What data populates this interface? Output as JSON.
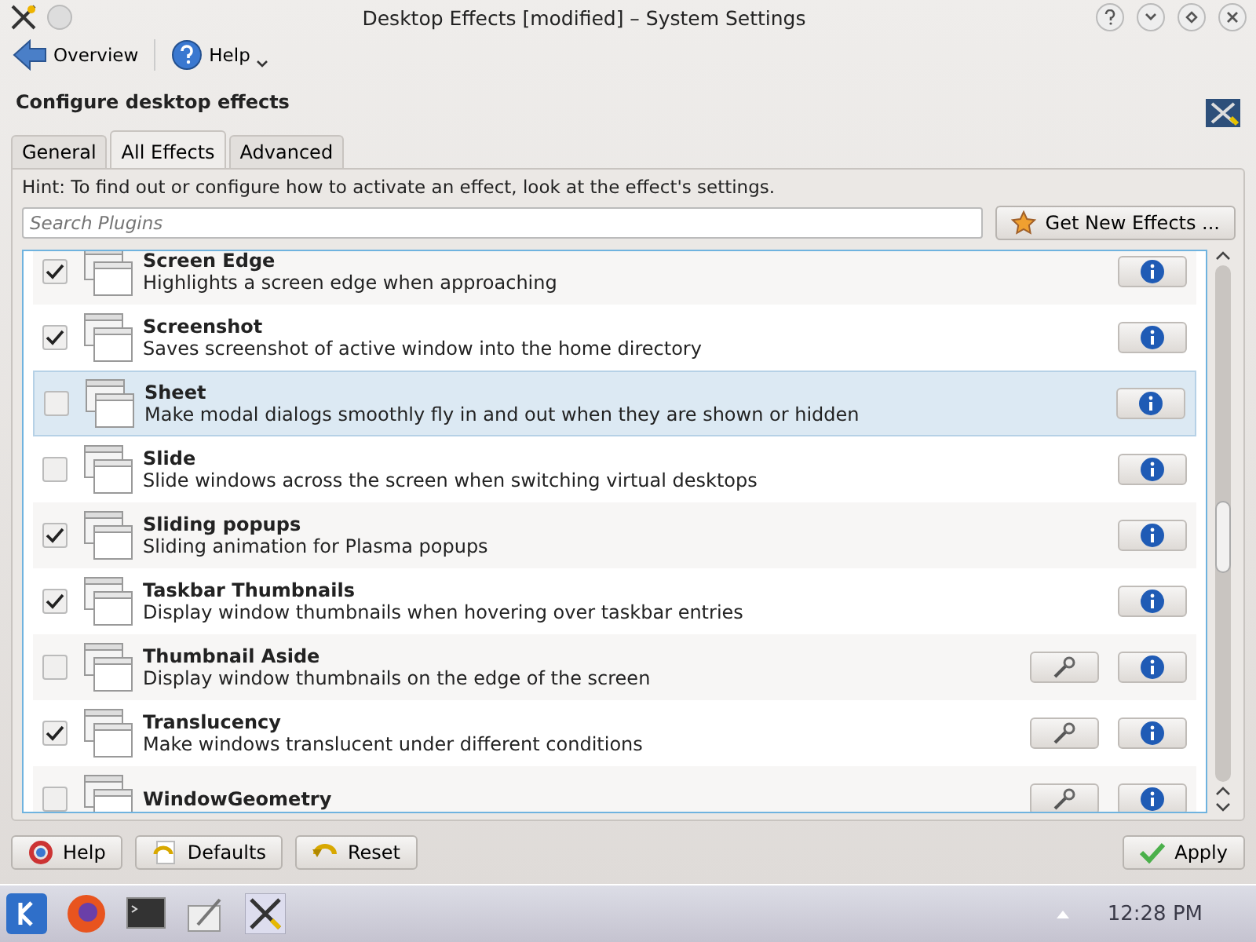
{
  "window": {
    "title": "Desktop Effects [modified] – System Settings"
  },
  "toolbar": {
    "items": [
      {
        "label": "Overview",
        "kind": "back"
      },
      {
        "label": "Help",
        "kind": "help"
      }
    ]
  },
  "header": {
    "title": "Configure desktop effects"
  },
  "tabs": [
    {
      "label": "General",
      "selected": false
    },
    {
      "label": "All Effects",
      "selected": true
    },
    {
      "label": "Advanced",
      "selected": false
    }
  ],
  "hint": "Hint: To find out or configure how to activate an effect, look at the effect's settings.",
  "search": {
    "placeholder": "Search Plugins"
  },
  "get_new_button": "Get New Effects ...",
  "effects": [
    {
      "name": "Screen Edge",
      "description": "Highlights a screen edge when approaching",
      "checked": true,
      "selected": false,
      "configurable": false
    },
    {
      "name": "Screenshot",
      "description": "Saves screenshot of active window into the home directory",
      "checked": true,
      "selected": false,
      "configurable": false
    },
    {
      "name": "Sheet",
      "description": "Make modal dialogs smoothly fly in and out when they are shown or hidden",
      "checked": false,
      "selected": true,
      "configurable": false
    },
    {
      "name": "Slide",
      "description": "Slide windows across the screen when switching virtual desktops",
      "checked": false,
      "selected": false,
      "configurable": false
    },
    {
      "name": "Sliding popups",
      "description": "Sliding animation for Plasma popups",
      "checked": true,
      "selected": false,
      "configurable": false
    },
    {
      "name": "Taskbar Thumbnails",
      "description": "Display window thumbnails when hovering over taskbar entries",
      "checked": true,
      "selected": false,
      "configurable": false
    },
    {
      "name": "Thumbnail Aside",
      "description": "Display window thumbnails on the edge of the screen",
      "checked": false,
      "selected": false,
      "configurable": true
    },
    {
      "name": "Translucency",
      "description": "Make windows translucent under different conditions",
      "checked": true,
      "selected": false,
      "configurable": true
    },
    {
      "name": "WindowGeometry",
      "checked": false,
      "selected": false,
      "configurable": true
    }
  ],
  "buttons": [
    {
      "label": "Help",
      "kind": "help"
    },
    {
      "label": "Defaults",
      "kind": "defaults"
    },
    {
      "label": "Reset",
      "kind": "reset"
    }
  ],
  "apply_button": "Apply",
  "taskbar": {
    "clock": "12:28 PM"
  }
}
